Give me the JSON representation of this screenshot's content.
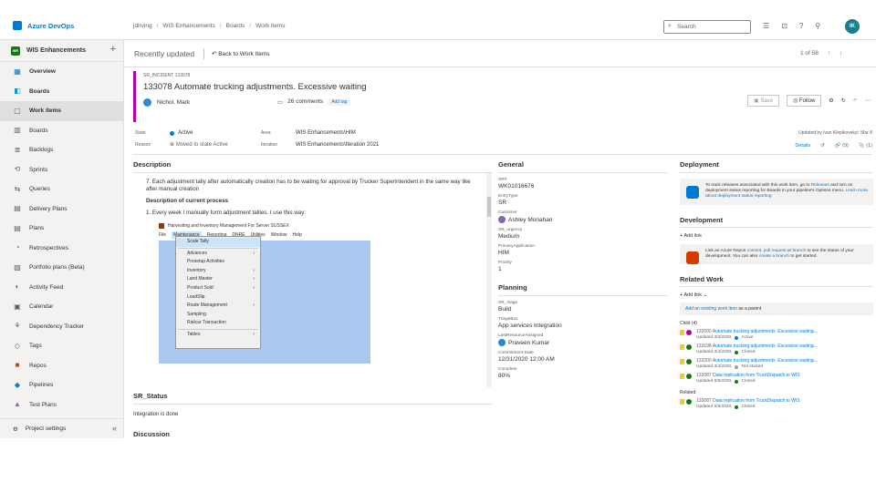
{
  "brand": "Azure DevOps",
  "breadcrumbs": [
    "jdirving",
    "WIS Enhancements",
    "Boards",
    "Work items"
  ],
  "search_placeholder": "Search",
  "avatar_initials": "IK",
  "project": {
    "name": "WIS Enhancements",
    "badge": "WE"
  },
  "nav": [
    {
      "label": "Overview",
      "icon": "overview-icon",
      "section": true
    },
    {
      "label": "Boards",
      "icon": "boards-icon",
      "section": true
    },
    {
      "label": "Work items",
      "icon": "work-items-icon",
      "active": true
    },
    {
      "label": "Boards",
      "icon": "board-icon"
    },
    {
      "label": "Backlogs",
      "icon": "backlogs-icon"
    },
    {
      "label": "Sprints",
      "icon": "sprints-icon"
    },
    {
      "label": "Queries",
      "icon": "queries-icon"
    },
    {
      "label": "Delivery Plans",
      "icon": "delivery-plans-icon"
    },
    {
      "label": "Plans",
      "icon": "plans-icon"
    },
    {
      "label": "Retrospectives",
      "icon": "retrospectives-icon"
    },
    {
      "label": "Portfolio plans (Beta)",
      "icon": "portfolio-icon"
    },
    {
      "label": "Activity Feed",
      "icon": "activity-icon"
    },
    {
      "label": "Calendar",
      "icon": "calendar-icon"
    },
    {
      "label": "Dependency Tracker",
      "icon": "dependency-icon"
    },
    {
      "label": "Tags",
      "icon": "tags-icon"
    },
    {
      "label": "Repos",
      "icon": "repos-icon"
    },
    {
      "label": "Pipelines",
      "icon": "pipelines-icon"
    },
    {
      "label": "Test Plans",
      "icon": "test-plans-icon"
    }
  ],
  "project_settings": "Project settings",
  "recent": "Recently updated",
  "back": "Back to Work Items",
  "pager": "1 of 58",
  "work_item": {
    "type": "SR_INCIDENT 133078",
    "title": "133078  Automate trucking adjustments. Excessive waiting",
    "assignee": "Nichol, Mark",
    "comments": "26 comments",
    "add_tag": "Add tag",
    "save": "Save",
    "follow": "Follow",
    "state_label": "State",
    "state": "Active",
    "reason_label": "Reason",
    "reason": "Moved to state Active",
    "area_label": "Area",
    "area": "WIS Enhancements\\HIM",
    "iteration_label": "Iteration",
    "iteration": "WIS Enhancements\\Iteration 2021",
    "updated_by": "Updated by Ivan Klepikovskyi: Mar 8",
    "details_tab": "Details",
    "links_count": "(9)",
    "attach_count": "(1)"
  },
  "description": {
    "head": "Description",
    "line7": "7. Each adjustment tally after automatically creation has to be waiting for approval by Trucker Superintendent in the same way like after manual creation",
    "current_head": "Description of current process",
    "line1": "1. Every week I manually form adjustment tallies. I use this way:",
    "embed_title": "Harvesting and Inventory Management For Server SUSSEX",
    "menubar": [
      "File",
      "Maintenance",
      "Reporting",
      "DNRE",
      "Utilities",
      "Window",
      "Help"
    ],
    "dropdown": [
      "Scale Tally",
      "Advances",
      "Presetup Activities",
      "Inventory",
      "Land Master",
      "Product Sold",
      "LoadSlip",
      "Route Management",
      "Sampling",
      "Railcar Transaction",
      "Tables"
    ]
  },
  "sr_status": {
    "head": "SR_Status",
    "value": "Integration is done"
  },
  "discussion": "Discussion",
  "general": {
    "head": "General",
    "fields": [
      {
        "label": "SR#",
        "value": "WK01016676"
      },
      {
        "label": "EntryType",
        "value": "SR"
      },
      {
        "label": "Customer",
        "value": "Ashley Monahan"
      },
      {
        "label": "SR_urgency",
        "value": "Medium"
      },
      {
        "label": "PrimaryApplication",
        "value": "HIM"
      },
      {
        "label": "Priority",
        "value": "1"
      }
    ]
  },
  "planning": {
    "head": "Planning",
    "fields": [
      {
        "label": "SR_stage",
        "value": "Build"
      },
      {
        "label": "TriageBox",
        "value": "App services Integration"
      },
      {
        "label": "LastResourceAssigned",
        "value": "Praveen Kumar"
      },
      {
        "label": "Commitment Date",
        "value": "12/31/2020 12:00 AM"
      },
      {
        "label": "Complete",
        "value": "80%"
      }
    ]
  },
  "deployment": {
    "head": "Deployment",
    "text_a": "To track releases associated with this work item, go to",
    "link_a": "Releases",
    "text_b": "and turn on deployment status reporting for Boards in your pipeline's Options menu.",
    "link_b": "Learn more about deployment status reporting"
  },
  "development": {
    "head": "Development",
    "add_link": "Add link",
    "text_a": "Link an Azure Repos",
    "link_a": "commit, pull request",
    "text_b": "or",
    "link_b": "branch",
    "text_c": "to see the status of your development. You can also",
    "link_c": "create a branch",
    "text_d": "to get started."
  },
  "related": {
    "head": "Related Work",
    "add_link": "Add link",
    "add_existing": "Add an existing work item",
    "as_parent": "as a parent",
    "child_label": "Child (4)",
    "children": [
      {
        "id": "133090",
        "title": "Automate trucking adjustments. Excessive waiting...",
        "updated": "Updated 3/3/2020,",
        "state": "Active",
        "color": "#b4009e",
        "dot": "#0078d4"
      },
      {
        "id": "133198",
        "title": "Automate trucking adjustments. Excessive waiting...",
        "updated": "Updated 3/4/2020,",
        "state": "Closed",
        "color": "#107c10",
        "dot": "#107c10"
      },
      {
        "id": "133200",
        "title": "Automate trucking adjustments. Excessive waiting...",
        "updated": "Updated 3/4/2020,",
        "state": "Not started",
        "color": "#107c10",
        "dot": "#a19f9d"
      },
      {
        "id": "133087",
        "title": "Data replication from TruckDispatch to WIS",
        "updated": "Updated 6/9/2020,",
        "state": "Closed",
        "color": "#107c10",
        "dot": "#107c10"
      }
    ],
    "related_label": "Related",
    "related_item": {
      "id": "133087",
      "title": "Data replication from TruckDispatch to WIS",
      "updated": "Updated 6/9/2020,",
      "state": "Closed"
    }
  }
}
